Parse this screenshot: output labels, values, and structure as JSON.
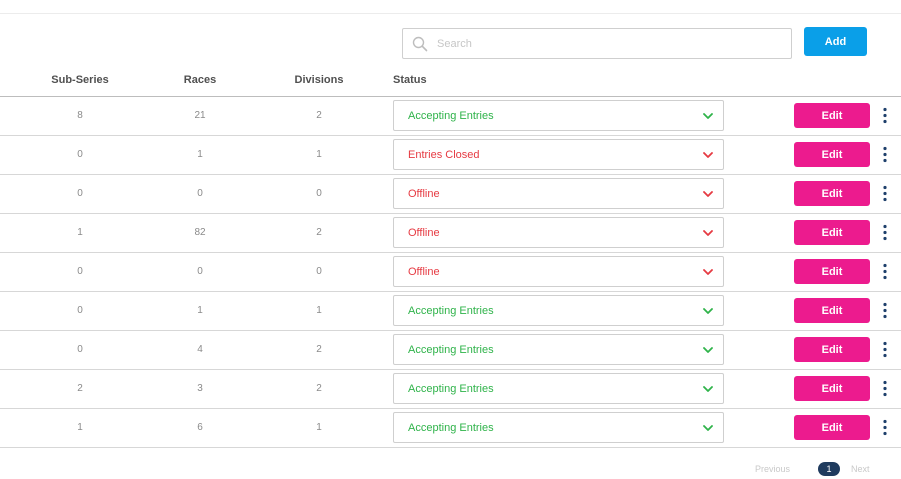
{
  "toolbar": {
    "search_placeholder": "Search",
    "add_label": "Add"
  },
  "table": {
    "columns": [
      "Sub-Series",
      "Races",
      "Divisions",
      "Status"
    ],
    "edit_label": "Edit",
    "rows": [
      {
        "sub_series": "8",
        "races": "21",
        "divisions": "2",
        "status": "Accepting Entries",
        "status_color": "#2fb34a"
      },
      {
        "sub_series": "0",
        "races": "1",
        "divisions": "1",
        "status": "Entries Closed",
        "status_color": "#e63a42"
      },
      {
        "sub_series": "0",
        "races": "0",
        "divisions": "0",
        "status": "Offline",
        "status_color": "#e63a42"
      },
      {
        "sub_series": "1",
        "races": "82",
        "divisions": "2",
        "status": "Offline",
        "status_color": "#e63a42"
      },
      {
        "sub_series": "0",
        "races": "0",
        "divisions": "0",
        "status": "Offline",
        "status_color": "#e63a42"
      },
      {
        "sub_series": "0",
        "races": "1",
        "divisions": "1",
        "status": "Accepting Entries",
        "status_color": "#2fb34a"
      },
      {
        "sub_series": "0",
        "races": "4",
        "divisions": "2",
        "status": "Accepting Entries",
        "status_color": "#2fb34a"
      },
      {
        "sub_series": "2",
        "races": "3",
        "divisions": "2",
        "status": "Accepting Entries",
        "status_color": "#2fb34a"
      },
      {
        "sub_series": "1",
        "races": "6",
        "divisions": "1",
        "status": "Accepting Entries",
        "status_color": "#2fb34a"
      }
    ]
  },
  "pagination": {
    "previous_label": "Previous",
    "current_page": "1",
    "next_label": "Next"
  },
  "colors": {
    "add_button": "#0a9fe8",
    "edit_button": "#ec1b8e",
    "status_green": "#2fb34a",
    "status_red": "#e63a42",
    "pager_active": "#1f3b5e"
  },
  "icons": {
    "search": "search-icon",
    "dropdown": "chevron-down-icon",
    "row_menu": "kebab-menu-icon"
  }
}
